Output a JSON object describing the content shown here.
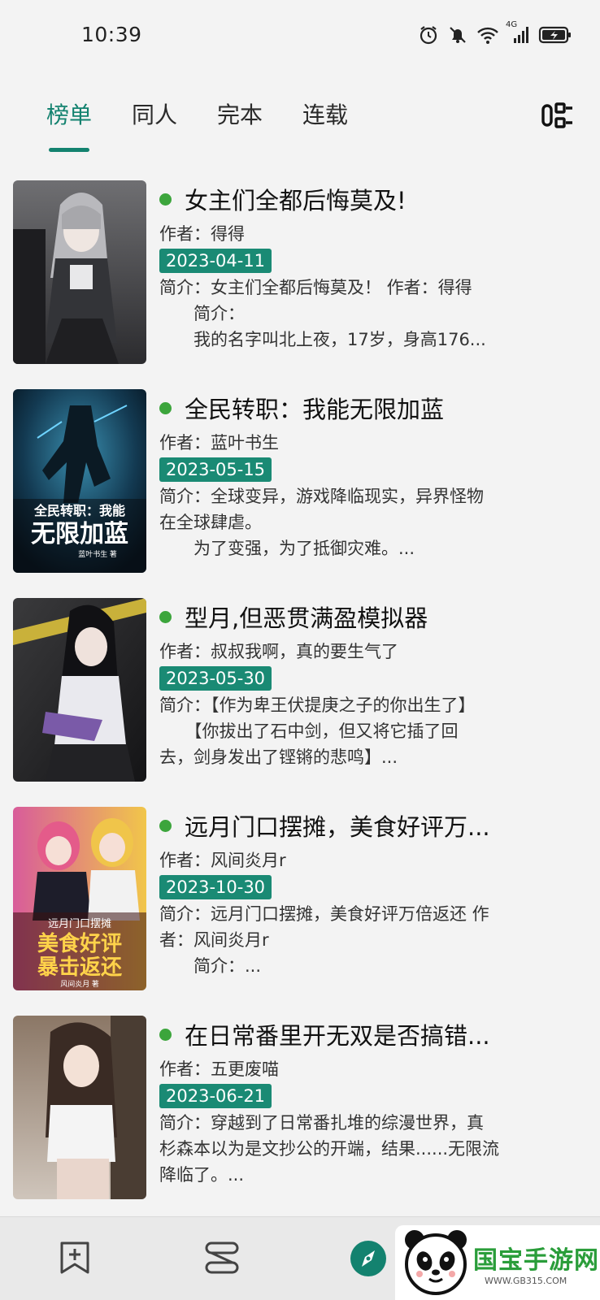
{
  "status_bar": {
    "time": "10:39",
    "network_label": "4G",
    "icons": [
      "alarm-icon",
      "mute-icon",
      "wifi-icon",
      "signal-icon",
      "battery-charging-icon"
    ]
  },
  "tabs": [
    {
      "label": "榜单",
      "active": true
    },
    {
      "label": "同人",
      "active": false
    },
    {
      "label": "完本",
      "active": false
    },
    {
      "label": "连载",
      "active": false
    }
  ],
  "filter_icon": "filter-icon",
  "books": [
    {
      "title": "女主们全都后悔莫及!",
      "author": "作者：得得",
      "date": "2023-04-11",
      "intro": [
        "简介：女主们全都后悔莫及！ 作者：得得",
        "　　简介：",
        "　　我的名字叫北上夜，17岁，身高176..."
      ],
      "cover_theme": "gray"
    },
    {
      "title": "全民转职：我能无限加蓝",
      "author": "作者：蓝叶书生",
      "date": "2023-05-15",
      "intro": [
        "简介：全球变异，游戏降临现实，异界怪物",
        "在全球肆虐。",
        "　　为了变强，为了抵御灾难。..."
      ],
      "cover_theme": "blue",
      "cover_text": [
        "全民转职：我能",
        "无限加蓝",
        "蓝叶书生 著"
      ]
    },
    {
      "title": "型月,但恶贯满盈模拟器",
      "author": "作者：叔叔我啊，真的要生气了",
      "date": "2023-05-30",
      "intro": [
        "简介：【作为卑王伏提庚之子的你出生了】",
        "　　【你拔出了石中剑，但又将它插了回",
        "去，剑身发出了铿锵的悲鸣】..."
      ],
      "cover_theme": "dark"
    },
    {
      "title": "远月门口摆摊，美食好评万...",
      "author": "作者：风间炎月r",
      "date": "2023-10-30",
      "intro": [
        "简介：远月门口摆摊，美食好评万倍返还 作",
        "者：风间炎月r",
        "　　简介：..."
      ],
      "cover_theme": "colorful",
      "cover_text": [
        "远月门口摆摊",
        "美食好评",
        "暴击返还",
        "风间炎月 著"
      ]
    },
    {
      "title": "在日常番里开无双是否搞错...",
      "author": "作者：五更废喵",
      "date": "2023-06-21",
      "intro": [
        "简介：穿越到了日常番扎堆的综漫世界，真",
        "杉森本以为是文抄公的开端，结果......无限流",
        "降临了。..."
      ],
      "cover_theme": "brown"
    }
  ],
  "bottom_nav": [
    {
      "icon": "bookmark-add-icon",
      "active": false
    },
    {
      "icon": "bookshelf-icon",
      "active": false
    },
    {
      "icon": "compass-icon",
      "active": true
    }
  ],
  "watermark": {
    "brand": "国宝手游网",
    "url": "WWW.GB315.COM"
  },
  "colors": {
    "accent": "#13826f",
    "badge": "#1a8a74",
    "dot": "#3ca53c",
    "background": "#f3f3f3"
  }
}
